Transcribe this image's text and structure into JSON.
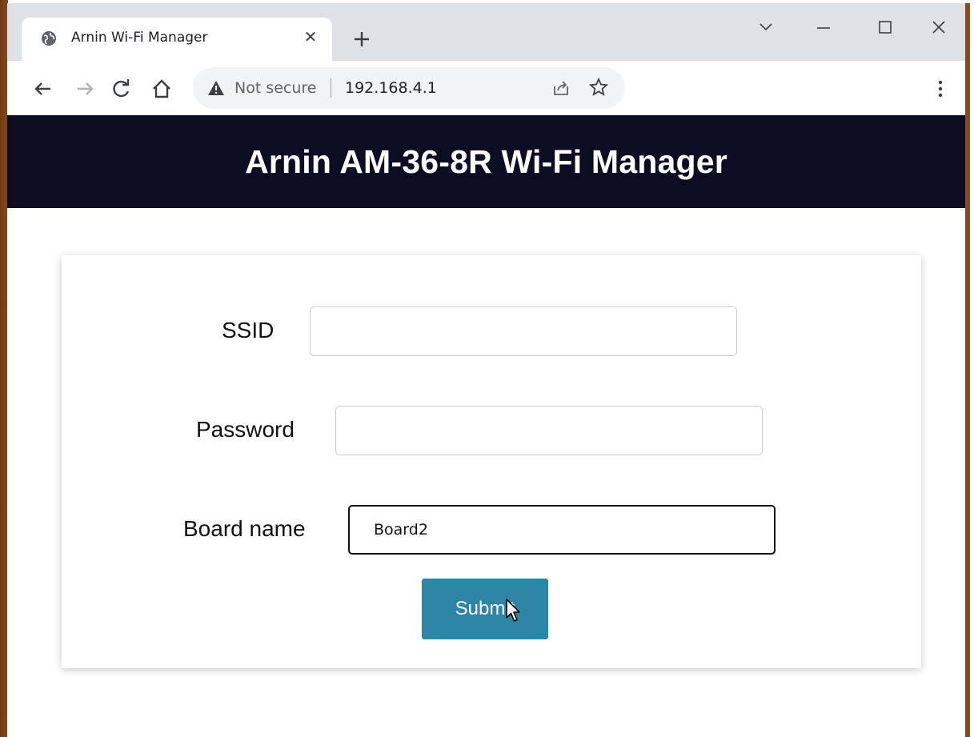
{
  "browser": {
    "tab_title": "Arnin Wi-Fi Manager",
    "security_label": "Not secure",
    "url": "192.168.4.1"
  },
  "page": {
    "heading": "Arnin AM-36-8R Wi-Fi Manager"
  },
  "form": {
    "ssid_label": "SSID",
    "ssid_value": "",
    "password_label": "Password",
    "password_value": "",
    "board_name_label": "Board name",
    "board_name_value": "Board2",
    "submit_label": "Submit"
  },
  "colors": {
    "header_bg": "#0c0d22",
    "submit_bg": "#2e86a6"
  },
  "icons": [
    "globe-icon",
    "close-icon",
    "plus-icon",
    "chevron-down-icon",
    "minimize-icon",
    "maximize-icon",
    "window-close-icon",
    "back-arrow-icon",
    "forward-arrow-icon",
    "reload-icon",
    "home-icon",
    "warning-icon",
    "share-icon",
    "star-icon",
    "kebab-menu-icon",
    "mouse-pointer-icon"
  ]
}
